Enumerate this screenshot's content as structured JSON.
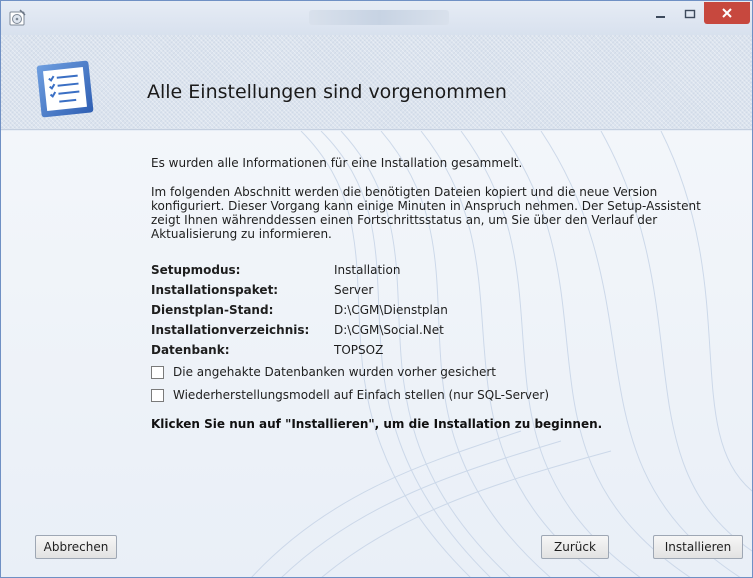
{
  "window": {
    "icon": "setup-disc-icon",
    "title_obscured": true,
    "controls": {
      "minimize": "minimize-icon",
      "maximize": "maximize-icon",
      "close": "close-icon"
    },
    "close_color": "#c7483e",
    "border_color": "#6f90c4"
  },
  "header": {
    "icon": "checklist-document-icon",
    "title": "Alle Einstellungen sind vorgenommen"
  },
  "content": {
    "intro": "Es wurden alle Informationen für eine Installation gesammelt.",
    "description": "Im folgenden Abschnitt werden die benötigten Dateien kopiert und die neue Version konfiguriert. Dieser Vorgang kann einige Minuten in Anspruch nehmen. Der Setup-Assistent zeigt Ihnen währenddessen einen Fortschrittsstatus an, um Sie über den Verlauf der Aktualisierung zu informieren.",
    "summary": [
      {
        "label": "Setupmodus:",
        "value": "Installation"
      },
      {
        "label": "Installationspaket:",
        "value": "Server"
      },
      {
        "label": "Dienstplan-Stand:",
        "value": "D:\\CGM\\Dienstplan"
      },
      {
        "label": "Installationverzeichnis:",
        "value": "D:\\CGM\\Social.Net"
      },
      {
        "label": "Datenbank:",
        "value": "TOPSOZ"
      }
    ],
    "checkboxes": [
      {
        "label": "Die angehakte Datenbanken wurden vorher gesichert",
        "checked": false
      },
      {
        "label": "Wiederherstellungsmodell auf Einfach stellen (nur SQL-Server)",
        "checked": false
      }
    ],
    "instruction": "Klicken Sie nun auf \"Installieren\", um die Installation zu beginnen."
  },
  "buttons": {
    "cancel": "Abbrechen",
    "back": "Zurück",
    "install": "Installieren"
  }
}
